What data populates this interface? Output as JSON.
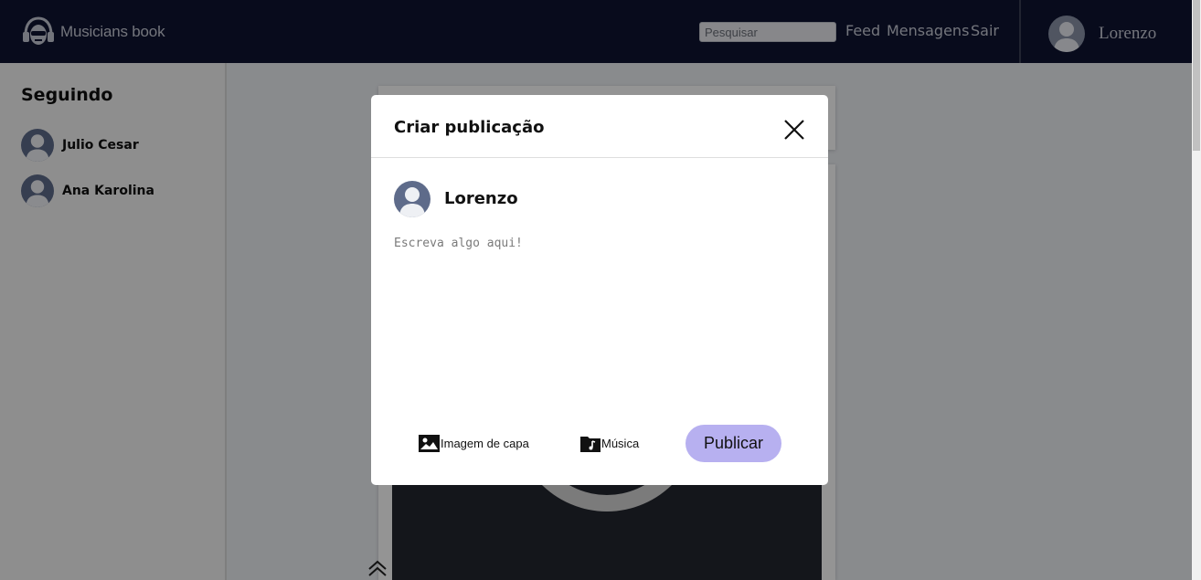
{
  "header": {
    "app_name": "Musicians book",
    "search_placeholder": "Pesquisar",
    "nav": [
      "Feed",
      "Mensagens",
      "Sair"
    ],
    "user_name": "Lorenzo"
  },
  "sidebar": {
    "title": "Seguindo",
    "following": [
      "Julio Cesar",
      "Ana Karolina"
    ]
  },
  "modal": {
    "title": "Criar publicação",
    "author": "Lorenzo",
    "text_placeholder": "Escreva algo aqui!",
    "cover_image_label": "Imagem de capa",
    "music_label": "Música",
    "publish_label": "Publicar"
  },
  "colors": {
    "navbar": "#0f1431",
    "publish_button": "#b7b0f0",
    "overlay": "rgba(0,0,0,0.42)"
  }
}
